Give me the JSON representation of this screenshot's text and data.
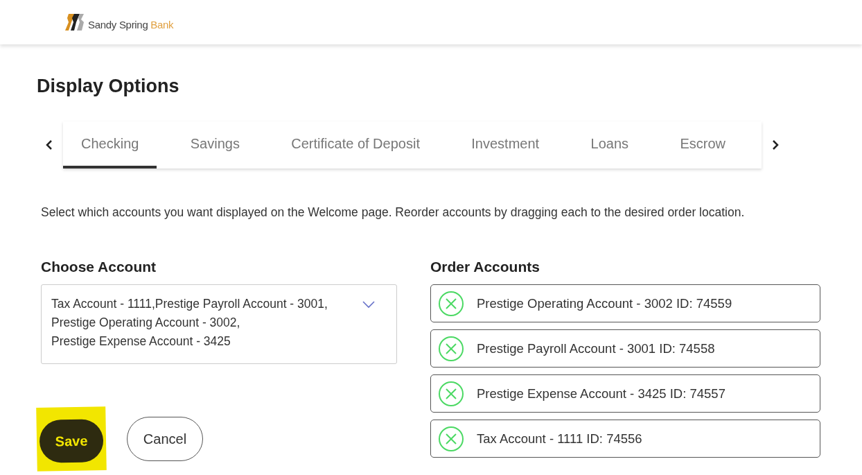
{
  "header": {
    "logo": {
      "name": "Sandy Spring",
      "accent": "Bank"
    }
  },
  "title": "Display Options",
  "tabs": [
    {
      "label": "Checking",
      "selected": true
    },
    {
      "label": "Savings",
      "selected": false
    },
    {
      "label": "Certificate of Deposit",
      "selected": false
    },
    {
      "label": "Investment",
      "selected": false
    },
    {
      "label": "Loans",
      "selected": false
    },
    {
      "label": "Escrow",
      "selected": false
    }
  ],
  "instructions": "Select which accounts you want displayed on the Welcome page. Reorder accounts by dragging each to the desired order location.",
  "choose_account": {
    "heading": "Choose Account",
    "value_lines": [
      "Tax Account - 1111,Prestige Payroll Account - 3001,",
      "Prestige Operating Account - 3002,",
      "Prestige Expense Account - 3425"
    ]
  },
  "order_accounts": {
    "heading": "Order Accounts",
    "items": [
      {
        "label": "Prestige Operating Account - 3002 ID: 74559"
      },
      {
        "label": "Prestige Payroll Account - 3001 ID: 74558"
      },
      {
        "label": "Prestige Expense Account - 3425 ID: 74557"
      },
      {
        "label": "Tax Account - 1111 ID: 74556"
      }
    ]
  },
  "buttons": [
    {
      "label": "Save",
      "kind": "primary",
      "highlighted": true
    },
    {
      "label": "Cancel",
      "kind": "secondary",
      "highlighted": false
    }
  ]
}
